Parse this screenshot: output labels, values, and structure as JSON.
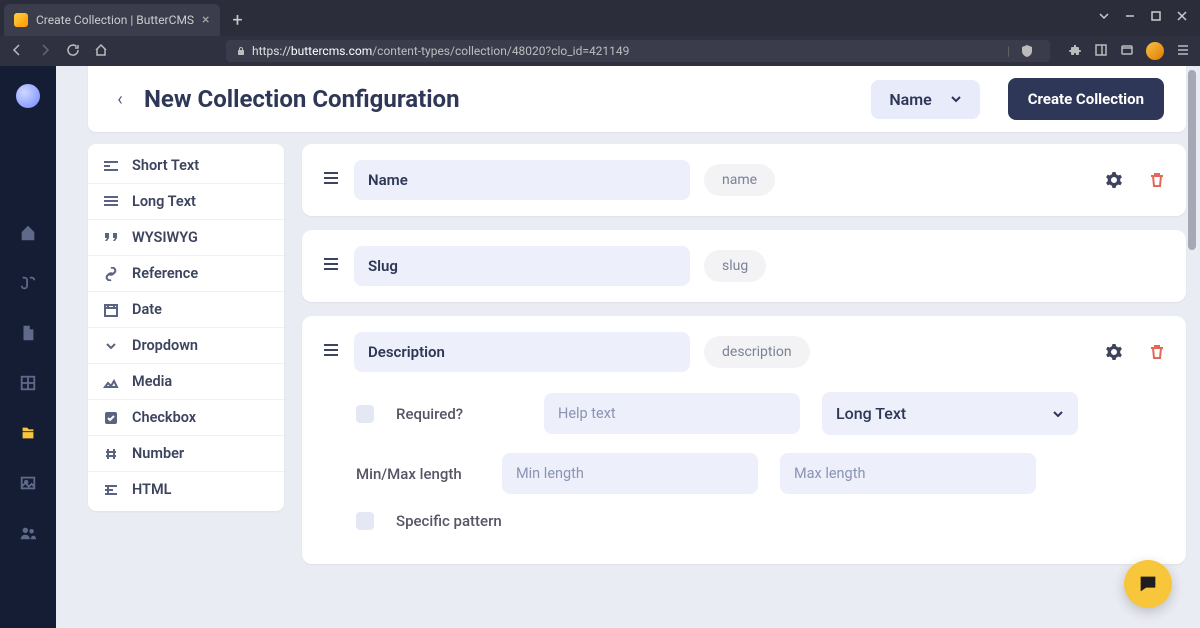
{
  "browser": {
    "tab_title": "Create Collection | ButterCMS",
    "url": "https://buttercms.com/content-types/collection/48020?clo_id=421149",
    "url_host": "buttercms.com",
    "url_path": "/content-types/collection/48020?clo_id=421149"
  },
  "header": {
    "title": "New Collection Configuration",
    "name_dropdown": "Name",
    "create_button": "Create Collection"
  },
  "field_palette": [
    {
      "label": "Short Text",
      "icon": "short-text"
    },
    {
      "label": "Long Text",
      "icon": "long-text"
    },
    {
      "label": "WYSIWYG",
      "icon": "quote"
    },
    {
      "label": "Reference",
      "icon": "link"
    },
    {
      "label": "Date",
      "icon": "calendar"
    },
    {
      "label": "Dropdown",
      "icon": "chevron"
    },
    {
      "label": "Media",
      "icon": "image"
    },
    {
      "label": "Checkbox",
      "icon": "checkbox"
    },
    {
      "label": "Number",
      "icon": "hash"
    },
    {
      "label": "HTML",
      "icon": "html"
    }
  ],
  "fields": [
    {
      "name": "Name",
      "slug": "name",
      "expanded": false
    },
    {
      "name": "Slug",
      "slug": "slug",
      "expanded": false,
      "no_gear": true
    },
    {
      "name": "Description",
      "slug": "description",
      "expanded": true
    }
  ],
  "field_detail": {
    "required_label": "Required?",
    "help_placeholder": "Help text",
    "type_value": "Long Text",
    "minmax_label": "Min/Max length",
    "min_placeholder": "Min length",
    "max_placeholder": "Max length",
    "pattern_label": "Specific pattern"
  }
}
